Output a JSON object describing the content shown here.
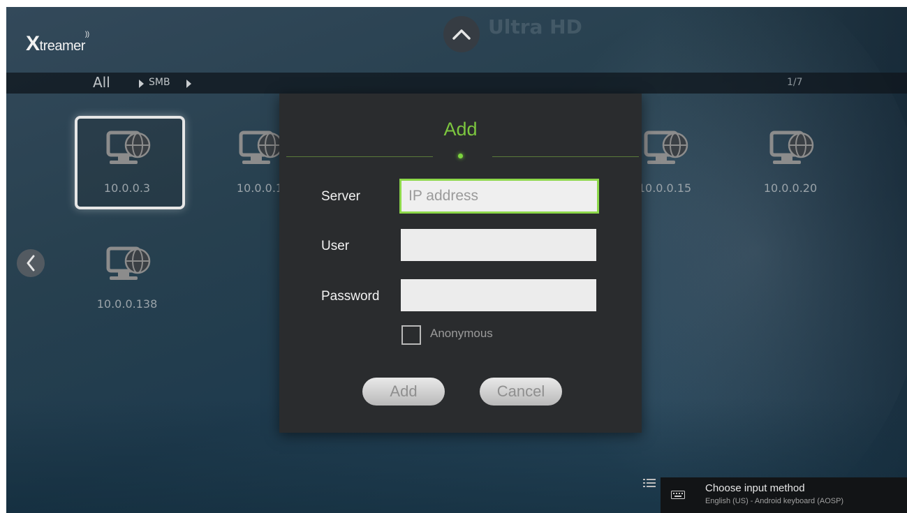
{
  "app": {
    "brand_x": "X",
    "brand_rest": "treamer",
    "background_text": "Ultra HD"
  },
  "breadcrumb": {
    "root": "All",
    "current": "SMB",
    "page": "1/7"
  },
  "servers": [
    {
      "label": "10.0.0.3",
      "selected": true
    },
    {
      "label": "10.0.0.1"
    },
    {
      "label": "10.0.0.15"
    },
    {
      "label": "10.0.0.20"
    },
    {
      "label": "10.0.0.138"
    }
  ],
  "dialog": {
    "title": "Add",
    "server_label": "Server",
    "server_placeholder": "IP address",
    "user_label": "User",
    "user_value": "",
    "password_label": "Password",
    "password_value": "",
    "anonymous_label": "Anonymous",
    "anonymous_checked": false,
    "add_label": "Add",
    "cancel_label": "Cancel"
  },
  "ime": {
    "title": "Choose input method",
    "subtitle": "English (US) - Android keyboard (AOSP)"
  },
  "icons": {
    "up": "chevron-up-icon",
    "left": "chevron-left-icon",
    "server": "network-computer-icon",
    "keyboard": "keyboard-icon",
    "menu": "list-menu-icon"
  },
  "colors": {
    "accent": "#7cc63f",
    "dialog_bg": "#2a2c2e",
    "input_focus": "#8dd84a"
  }
}
